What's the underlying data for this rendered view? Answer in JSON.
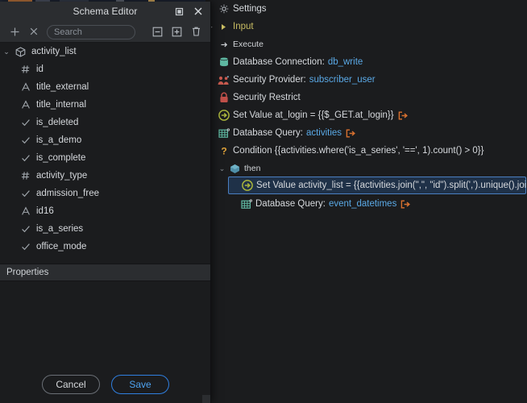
{
  "window": {
    "title": "Schema Editor",
    "titlebar_buttons": [
      {
        "name": "maximize",
        "glyph": "square"
      },
      {
        "name": "close",
        "glyph": "x"
      }
    ],
    "toolbar": {
      "add_label": "+",
      "remove_label": "×",
      "search_placeholder": "Search",
      "search_value": "",
      "collapse_all_label": "collapse-all",
      "expand_all_label": "expand-all",
      "delete_label": "delete"
    },
    "tree": {
      "root": {
        "label": "activity_list",
        "icon": "cube-icon",
        "expanded": true
      },
      "fields": [
        {
          "label": "id",
          "type_icon": "hash",
          "icon_name": "number-field-icon"
        },
        {
          "label": "title_external",
          "type_icon": "A",
          "icon_name": "text-field-icon"
        },
        {
          "label": "title_internal",
          "type_icon": "A",
          "icon_name": "text-field-icon"
        },
        {
          "label": "is_deleted",
          "type_icon": "check",
          "icon_name": "boolean-field-icon"
        },
        {
          "label": "is_a_demo",
          "type_icon": "check",
          "icon_name": "boolean-field-icon"
        },
        {
          "label": "is_complete",
          "type_icon": "check",
          "icon_name": "boolean-field-icon"
        },
        {
          "label": "activity_type",
          "type_icon": "hash",
          "icon_name": "number-field-icon"
        },
        {
          "label": "admission_free",
          "type_icon": "check",
          "icon_name": "boolean-field-icon"
        },
        {
          "label": "id16",
          "type_icon": "A",
          "icon_name": "text-field-icon"
        },
        {
          "label": "is_a_series",
          "type_icon": "check",
          "icon_name": "boolean-field-icon"
        },
        {
          "label": "office_mode",
          "type_icon": "check",
          "icon_name": "boolean-field-icon"
        }
      ]
    },
    "properties": {
      "header": "Properties"
    },
    "footer": {
      "cancel_label": "Cancel",
      "save_label": "Save"
    }
  },
  "flow": {
    "rows": [
      {
        "label": "Settings",
        "icon": "gear-icon",
        "indent": 0,
        "twisty": "",
        "style": "plain",
        "value": "",
        "has_go": false
      },
      {
        "label": "Input",
        "icon": "arrow-right-small-icon",
        "indent": 0,
        "twisty": "▸",
        "style": "input",
        "value": "",
        "has_go": false
      },
      {
        "label": "Execute",
        "icon": "play-icon",
        "indent": 0,
        "twisty": "",
        "style": "dim",
        "value": "",
        "has_go": false
      },
      {
        "label": "Database Connection:",
        "icon": "database-icon",
        "indent": 0,
        "twisty": "",
        "style": "plain",
        "value": "db_write",
        "value_color": "blue",
        "has_go": false
      },
      {
        "label": "Security Provider:",
        "icon": "users-icon",
        "indent": 0,
        "twisty": "",
        "style": "plain",
        "value": "subscriber_user",
        "value_color": "blue",
        "has_go": false
      },
      {
        "label": "Security Restrict",
        "icon": "lock-icon",
        "indent": 0,
        "twisty": "",
        "style": "plain",
        "value": "",
        "has_go": false
      },
      {
        "label": "Set Value at_login = {{$_GET.at_login}}",
        "icon": "set-value-icon",
        "indent": 0,
        "twisty": "",
        "style": "plain",
        "value": "",
        "has_go": true
      },
      {
        "label": "Database Query:",
        "icon": "table-query-icon",
        "indent": 0,
        "twisty": "",
        "style": "plain",
        "value": "activities",
        "value_color": "blue",
        "has_go": true
      },
      {
        "label": "Condition {{activities.where('is_a_series', '==', 1).count() > 0}}",
        "icon": "question-icon",
        "indent": 0,
        "twisty": "",
        "style": "plain",
        "value": "",
        "has_go": false
      },
      {
        "label": "then",
        "icon": "branch-icon",
        "indent": 1,
        "twisty": "⌄",
        "style": "dim",
        "value": "",
        "has_go": false
      },
      {
        "label": "Set Value activity_list = {{activities.join(\",\", \"id\").split(',').unique().join(',').split(',')}}",
        "icon": "set-value-icon",
        "indent": 2,
        "twisty": "",
        "style": "plain",
        "value": "",
        "has_go": false,
        "selected": true
      },
      {
        "label": "Database Query:",
        "icon": "table-query-icon",
        "indent": 2,
        "twisty": "",
        "style": "plain",
        "value": "event_datetimes",
        "value_color": "blue",
        "has_go": true
      }
    ]
  },
  "colors": {
    "accent_blue": "#4da2f0",
    "selection_bg": "#1f3148",
    "selection_border": "#4a7fc1",
    "value_blue": "#5aa9e6",
    "input_yellow": "#c9bd63",
    "go_orange": "#d9712f",
    "db_teal": "#5fb8a2",
    "lock_red": "#c0504a",
    "users_red": "#c85a4e",
    "set_value_olive": "#aab53c",
    "question_orange": "#e0a33a",
    "panel_bg": "#1b1c1e",
    "chrome_bg": "#2b2d30"
  }
}
